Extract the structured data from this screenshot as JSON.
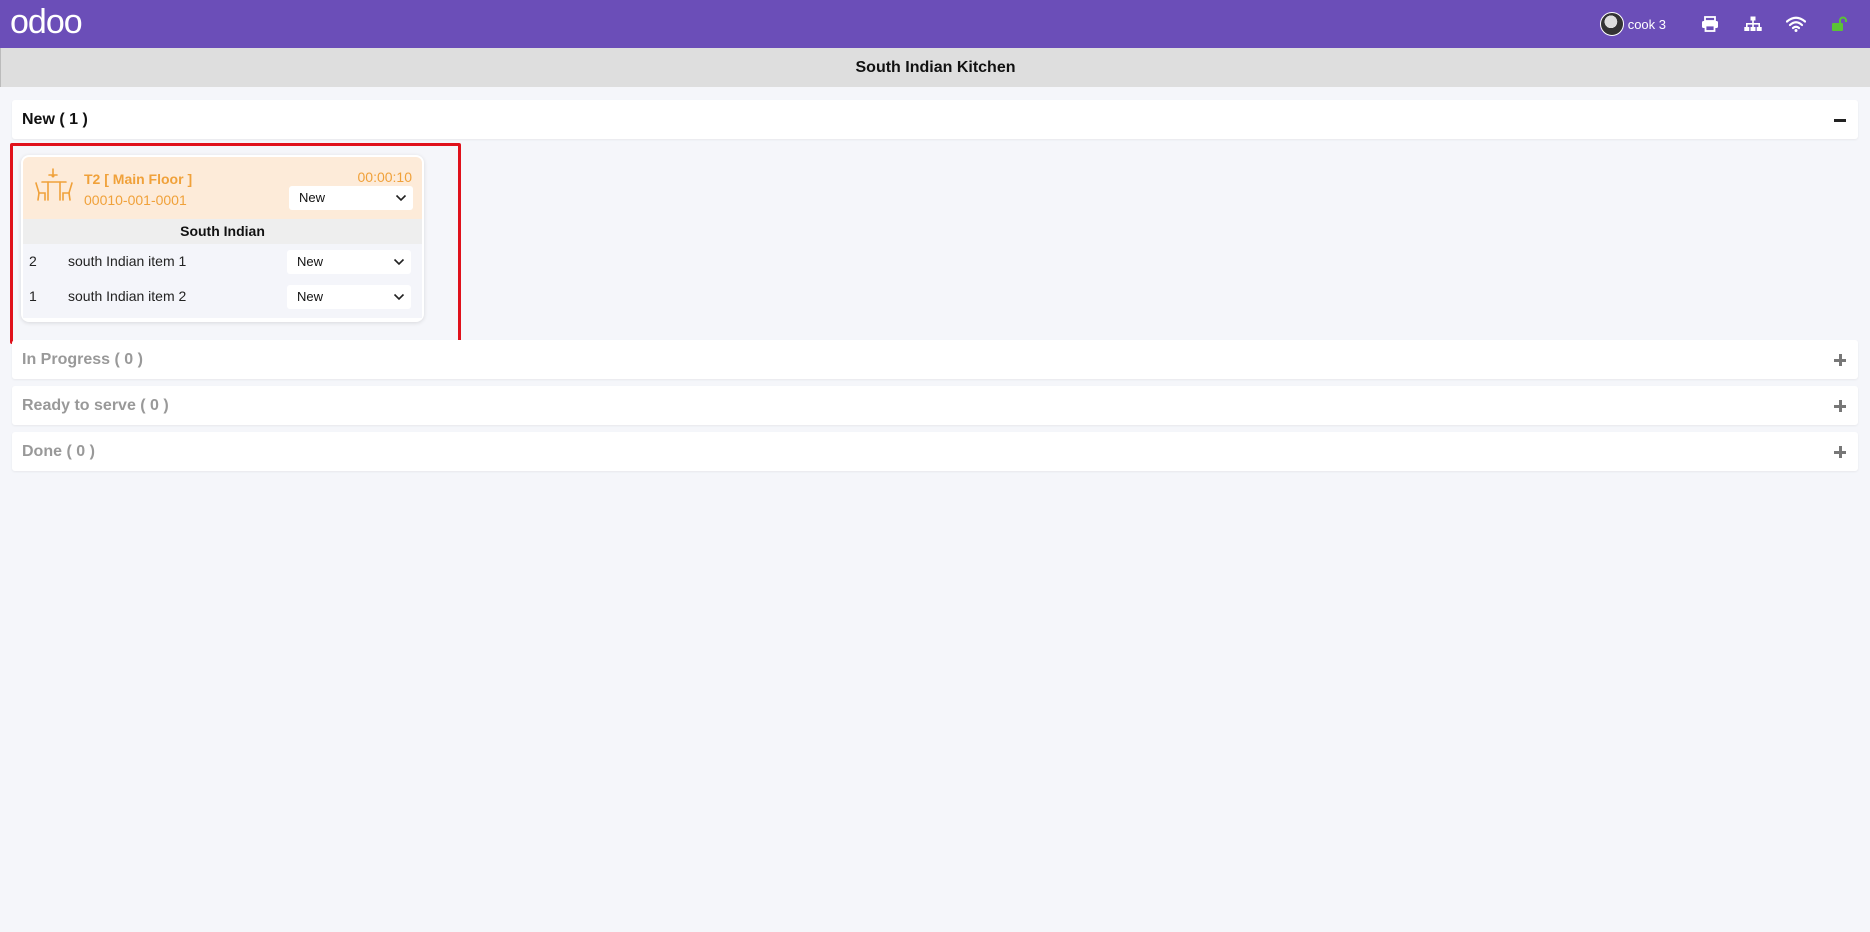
{
  "navbar": {
    "logo": "odoo",
    "user_name": "cook 3",
    "icons": [
      "printer-icon",
      "sitemap-icon",
      "wifi-icon",
      "unlock-icon"
    ],
    "bg_color": "#6b4eb8",
    "lock_color": "#5bc236"
  },
  "kitchen_title": "South Indian Kitchen",
  "sections": [
    {
      "label": "New ( 1 )",
      "state": "expanded"
    },
    {
      "label": "In Progress ( 0 )",
      "state": "collapsed"
    },
    {
      "label": "Ready to serve ( 0 )",
      "state": "collapsed"
    },
    {
      "label": "Done ( 0 )",
      "state": "collapsed"
    }
  ],
  "order_card": {
    "table": "T2 [ Main Floor ]",
    "reference": "00010-001-0001",
    "timer": "00:00:10",
    "status": "New",
    "category": "South Indian",
    "accent_color": "#f0a13a",
    "items": [
      {
        "qty": "2",
        "name": "south Indian item 1",
        "status": "New"
      },
      {
        "qty": "1",
        "name": "south Indian item 2",
        "status": "New"
      }
    ]
  }
}
